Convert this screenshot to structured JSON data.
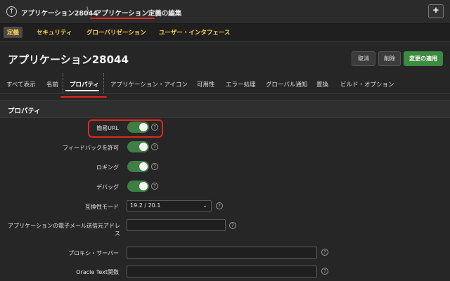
{
  "topbar": {
    "app_crumb": "アプリケーション28044",
    "current_crumb": "アプリケーション定義の編集",
    "separator": "\\"
  },
  "main_tabs": [
    {
      "label": "定義",
      "active": true
    },
    {
      "label": "セキュリティ",
      "active": false
    },
    {
      "label": "グローバリゼーション",
      "active": false
    },
    {
      "label": "ユーザー・インタフェース",
      "active": false
    }
  ],
  "header": {
    "title": "アプリケーション28044",
    "cancel_label": "取消",
    "delete_label": "削除",
    "apply_label": "変更の適用"
  },
  "sub_tabs": [
    {
      "label": "すべて表示",
      "active": false
    },
    {
      "label": "名前",
      "active": false
    },
    {
      "label": "プロパティ",
      "active": true
    },
    {
      "label": "アプリケーション・アイコン",
      "active": false
    },
    {
      "label": "可用性",
      "active": false
    },
    {
      "label": "エラー処理",
      "active": false
    },
    {
      "label": "グローバル通知",
      "active": false
    },
    {
      "label": "置換",
      "active": false
    },
    {
      "label": "ビルド・オプション",
      "active": false
    }
  ],
  "section": {
    "title": "プロパティ"
  },
  "form": {
    "friendly_url_label": "簡易URL",
    "friendly_url_on": true,
    "allow_feedback_label": "フィードバックを許可",
    "allow_feedback_on": true,
    "logging_label": "ロギング",
    "logging_on": true,
    "debug_label": "デバッグ",
    "debug_on": true,
    "compat_mode_label": "互換性モード",
    "compat_mode_value": "19.2 / 20.1",
    "email_from_label": "アプリケーションの電子メール送信元アドレス",
    "email_from_value": "",
    "proxy_label": "プロキシ・サーバー",
    "proxy_value": "",
    "oracle_text_label": "Oracle Text関数",
    "oracle_text_value": "",
    "help_symbol": "?"
  },
  "colors": {
    "accent_red": "#e0261f",
    "toggle_green": "#3f7f44",
    "tab_yellow": "#ffd04a",
    "apply_green": "#3d8a40"
  }
}
